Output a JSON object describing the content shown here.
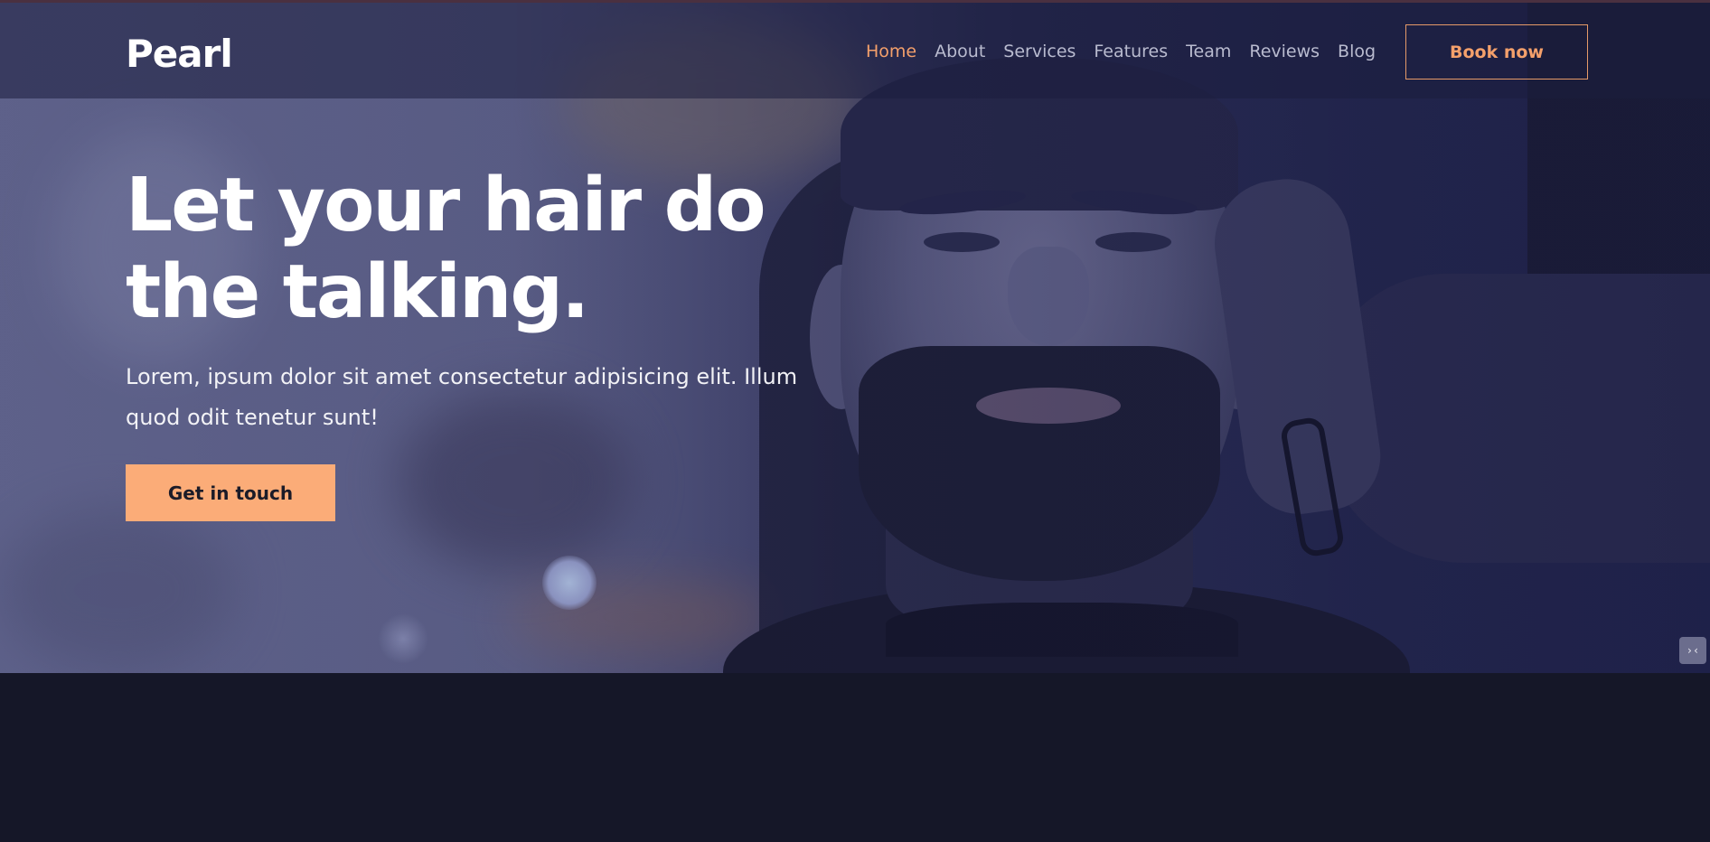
{
  "brand": {
    "logo": "Pearl"
  },
  "nav": {
    "items": [
      {
        "label": "Home",
        "active": true
      },
      {
        "label": "About",
        "active": false
      },
      {
        "label": "Services",
        "active": false
      },
      {
        "label": "Features",
        "active": false
      },
      {
        "label": "Team",
        "active": false
      },
      {
        "label": "Reviews",
        "active": false
      },
      {
        "label": "Blog",
        "active": false
      }
    ],
    "book_label": "Book now"
  },
  "hero": {
    "title_line1": "Let your hair do",
    "title_line2": "the talking.",
    "text": "Lorem, ipsum dolor sit amet consectetur adipisicing elit. Illum quod odit tenetur sunt!",
    "cta_label": "Get in touch"
  },
  "widget": {
    "glyph": "›‹"
  },
  "colors": {
    "accent": "#f4a06b",
    "cta_bg": "#fbac78",
    "page_bg": "#151728",
    "text_light": "#ffffff"
  }
}
